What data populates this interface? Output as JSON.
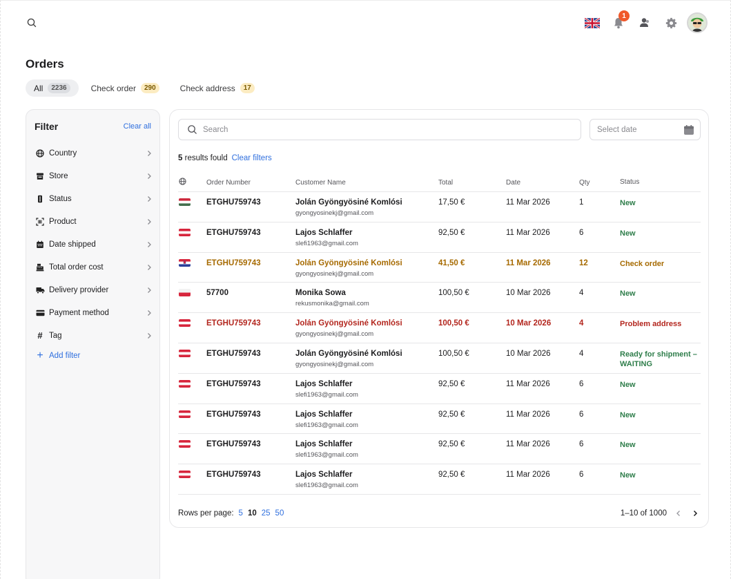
{
  "header": {
    "notification_count": "1",
    "icons": [
      "search-icon",
      "uk-flag-icon",
      "bell-icon",
      "users-icon",
      "gear-icon",
      "avatar"
    ]
  },
  "page": {
    "title": "Orders"
  },
  "tabs": [
    {
      "label": "All",
      "count": "2236",
      "active": true
    },
    {
      "label": "Check order",
      "count": "290",
      "active": false
    },
    {
      "label": "Check address",
      "count": "17",
      "active": false
    }
  ],
  "filter": {
    "title": "Filter",
    "clear_all": "Clear all",
    "items": [
      {
        "label": "Country",
        "icon": "globe-icon"
      },
      {
        "label": "Store",
        "icon": "store-icon"
      },
      {
        "label": "Status",
        "icon": "status-icon"
      },
      {
        "label": "Product",
        "icon": "barcode-icon"
      },
      {
        "label": "Date shipped",
        "icon": "calendar-icon"
      },
      {
        "label": "Total order cost",
        "icon": "cash-register-icon"
      },
      {
        "label": "Delivery provider",
        "icon": "truck-icon"
      },
      {
        "label": "Payment method",
        "icon": "credit-card-icon"
      },
      {
        "label": "Tag",
        "icon": "hashtag-icon"
      }
    ],
    "add_filter": "Add filter"
  },
  "search": {
    "placeholder": "Search"
  },
  "date_picker": {
    "placeholder": "Select date"
  },
  "results": {
    "count": "5",
    "text": "results fould",
    "clear_filters": "Clear filters"
  },
  "table": {
    "columns": {
      "order": "Order Number",
      "customer": "Customer Name",
      "total": "Total",
      "date": "Date",
      "qty": "Qty",
      "status": "Status"
    },
    "rows": [
      {
        "flag": "HU",
        "order": "ETGHU759743",
        "name": "Jolán Gyöngyösiné Komlósi",
        "email": "gyongyosinekj@gmail.com",
        "total": "17,50 €",
        "date": "11 Mar 2026",
        "qty": "1",
        "status": "New",
        "variant": "normal",
        "status_class": "status-new"
      },
      {
        "flag": "AT",
        "order": "ETGHU759743",
        "name": "Lajos Schlaffer",
        "email": "slefi1963@gmail.com",
        "total": "92,50 €",
        "date": "11 Mar 2026",
        "qty": "6",
        "status": "New",
        "variant": "normal",
        "status_class": "status-new"
      },
      {
        "flag": "HR",
        "order": "ETGHU759743",
        "name": "Jolán Gyöngyösiné Komlósi",
        "email": "gyongyosinekj@gmail.com",
        "total": "41,50 €",
        "date": "11 Mar 2026",
        "qty": "12",
        "status": "Check order",
        "variant": "warn",
        "status_class": "status-check"
      },
      {
        "flag": "PL",
        "order": "57700",
        "name": "Monika Sowa",
        "email": "rekusmonika@gmail.com",
        "total": "100,50 €",
        "date": "10 Mar 2026",
        "qty": "4",
        "status": "New",
        "variant": "normal",
        "status_class": "status-new"
      },
      {
        "flag": "AT",
        "order": "ETGHU759743",
        "name": "Jolán Gyöngyösiné Komlósi",
        "email": "gyongyosinekj@gmail.com",
        "total": "100,50 €",
        "date": "10 Mar 2026",
        "qty": "4",
        "status": "Problem address",
        "variant": "err",
        "status_class": "status-problem"
      },
      {
        "flag": "AT",
        "order": "ETGHU759743",
        "name": "Jolán Gyöngyösiné Komlósi",
        "email": "gyongyosinekj@gmail.com",
        "total": "100,50 €",
        "date": "10 Mar 2026",
        "qty": "4",
        "status": "Ready for shipment – WAITING",
        "variant": "normal",
        "status_class": "status-new"
      },
      {
        "flag": "AT",
        "order": "ETGHU759743",
        "name": "Lajos Schlaffer",
        "email": "slefi1963@gmail.com",
        "total": "92,50 €",
        "date": "11 Mar 2026",
        "qty": "6",
        "status": "New",
        "variant": "normal",
        "status_class": "status-new"
      },
      {
        "flag": "AT",
        "order": "ETGHU759743",
        "name": "Lajos Schlaffer",
        "email": "slefi1963@gmail.com",
        "total": "92,50 €",
        "date": "11 Mar 2026",
        "qty": "6",
        "status": "New",
        "variant": "normal",
        "status_class": "status-new"
      },
      {
        "flag": "AT",
        "order": "ETGHU759743",
        "name": "Lajos Schlaffer",
        "email": "slefi1963@gmail.com",
        "total": "92,50 €",
        "date": "11 Mar 2026",
        "qty": "6",
        "status": "New",
        "variant": "normal",
        "status_class": "status-new"
      },
      {
        "flag": "AT",
        "order": "ETGHU759743",
        "name": "Lajos Schlaffer",
        "email": "slefi1963@gmail.com",
        "total": "92,50 €",
        "date": "11 Mar 2026",
        "qty": "6",
        "status": "New",
        "variant": "normal",
        "status_class": "status-new"
      }
    ]
  },
  "pagination": {
    "rows_per_page_label": "Rows per page:",
    "options": [
      "5",
      "10",
      "25",
      "50"
    ],
    "selected": "10",
    "range": "1–10 of 1000"
  },
  "colors": {
    "accent": "#2f6fde",
    "new": "#2e7d4a",
    "warn": "#a66a00",
    "error": "#b3261e",
    "badge": "#f0592b"
  }
}
